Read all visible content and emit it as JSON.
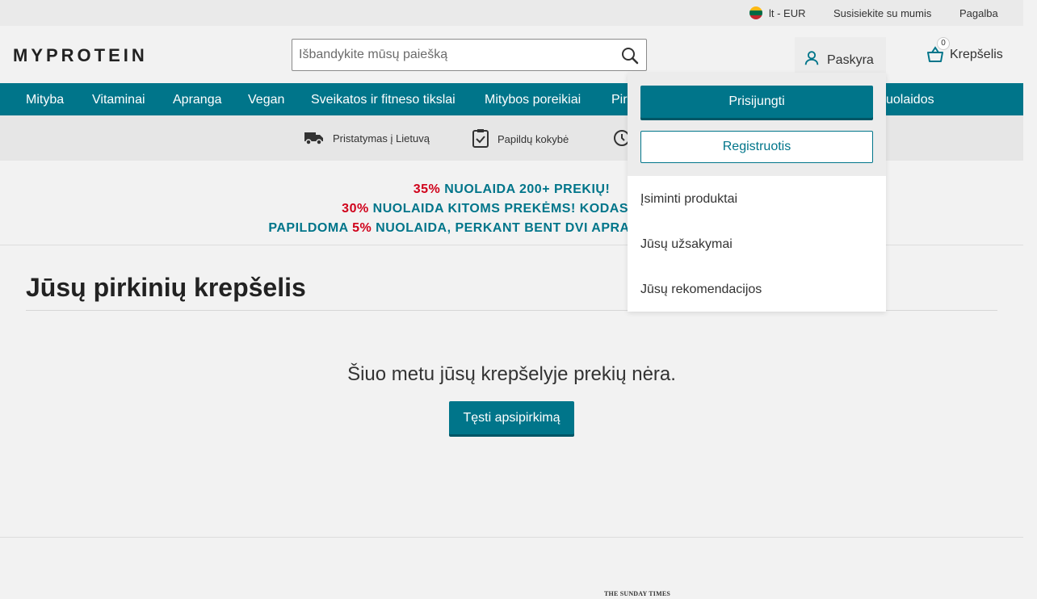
{
  "utility": {
    "locale": "lt - EUR",
    "contact": "Susisiekite su mumis",
    "help": "Pagalba"
  },
  "header": {
    "logo": "MYPROTEIN",
    "search_placeholder": "Išbandykite mūsų paiešką",
    "account": "Paskyra",
    "cart_label": "Krepšelis",
    "cart_count": "0"
  },
  "nav": {
    "items": [
      "Mityba",
      "Vitaminai",
      "Apranga",
      "Vegan",
      "Sveikatos ir fitneso tikslai",
      "Mitybos poreikiai",
      "Pir",
      "uolaidos"
    ]
  },
  "usp": {
    "items": [
      "Pristatymas į Lietuvą",
      "Papildų kokybė"
    ]
  },
  "promo": {
    "line1_pct": "35%",
    "line1_text": " NUOLAIDA 200+ PREKIŲ!",
    "line2_pct": "30%",
    "line2_text": " NUOLAIDA KITOMS PREKĖMS! KODAS:",
    "line3_pre": "PAPILDOMA ",
    "line3_pct": "5%",
    "line3_text": " NUOLAIDA, PERKANT BENT DVI APRA"
  },
  "main": {
    "title": "Jūsų pirkinių krepšelis",
    "empty_message": "Šiuo metu jūsų krepšelyje prekių nėra.",
    "continue_button": "Tęsti apsipirkimą"
  },
  "dropdown": {
    "login": "Prisijungti",
    "register": "Registruotis",
    "links": [
      "Įsiminti produktai",
      "Jūsų užsakymai",
      "Jūsų rekomendacijos"
    ]
  },
  "footer": {
    "press_logo": "THE SUNDAY TIMES"
  },
  "colors": {
    "brand": "#00758a",
    "sale_red": "#d0021b"
  }
}
